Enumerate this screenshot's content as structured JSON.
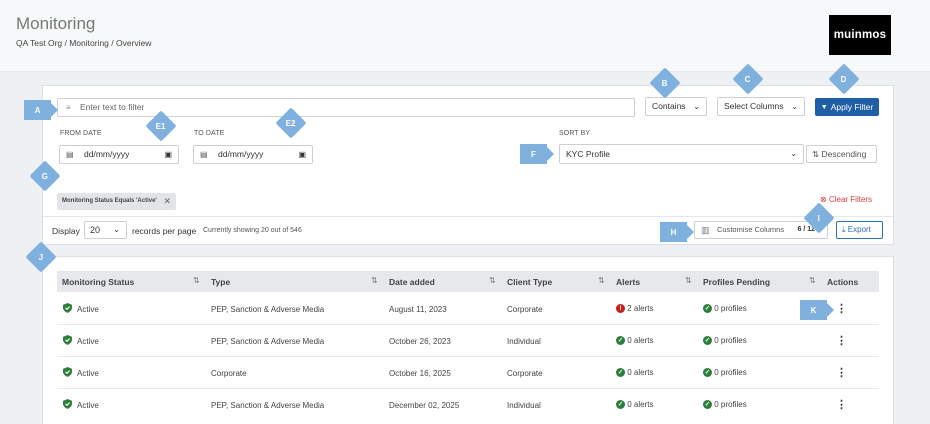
{
  "header": {
    "title": "Monitoring",
    "breadcrumb": "QA Test Org  /  Monitoring  /  Overview",
    "logo": "muinmos"
  },
  "filter": {
    "placeholder": "Enter text to filter",
    "operator": "Contains",
    "columns": "Select Columns",
    "apply": "Apply Filter",
    "from_label": "FROM DATE",
    "to_label": "TO DATE",
    "date_placeholder": "dd/mm/yyyy",
    "sort_label": "SORT BY",
    "sort_value": "KYC Profile",
    "sort_dir": "Descending",
    "chip": "Monitoring Status Equals 'Active'",
    "clear": "Clear Filters"
  },
  "toolbar": {
    "display": "Display",
    "per_page": "20",
    "records": "records per page",
    "showing": "Currently showing 20 out of 546",
    "customise": "Customise Columns",
    "col_count": "6 / 12",
    "export": "Export"
  },
  "table": {
    "headers": [
      "Monitoring Status",
      "Type",
      "Date added",
      "Client Type",
      "Alerts",
      "Profiles Pending",
      "Actions"
    ],
    "rows": [
      {
        "status": "Active",
        "type": "PEP, Sanction & Adverse Media",
        "date": "August 11, 2023",
        "client": "Corporate",
        "alerts": "2 alerts",
        "pending": "0 profiles",
        "alert_level": "red"
      },
      {
        "status": "Active",
        "type": "PEP, Sanction & Adverse Media",
        "date": "October 26, 2023",
        "client": "Individual",
        "alerts": "0 alerts",
        "pending": "0 profiles",
        "alert_level": "green"
      },
      {
        "status": "Active",
        "type": "Corporate",
        "date": "October 16, 2025",
        "client": "Corporate",
        "alerts": "0 alerts",
        "pending": "0 profiles",
        "alert_level": "green"
      },
      {
        "status": "Active",
        "type": "PEP, Sanction & Adverse Media",
        "date": "December 02, 2025",
        "client": "Individual",
        "alerts": "0 alerts",
        "pending": "0 profiles",
        "alert_level": "green"
      }
    ]
  },
  "markers": {
    "a": "A",
    "b": "B",
    "c": "C",
    "d": "D",
    "e1": "E1",
    "e2": "E2",
    "f": "F",
    "g": "G",
    "h": "H",
    "i": "I",
    "j": "J",
    "k": "K"
  },
  "colors": {
    "primary": "#1f5fa8",
    "marker": "#7fb0de",
    "danger": "#c62020",
    "success": "#2e7d3a"
  }
}
